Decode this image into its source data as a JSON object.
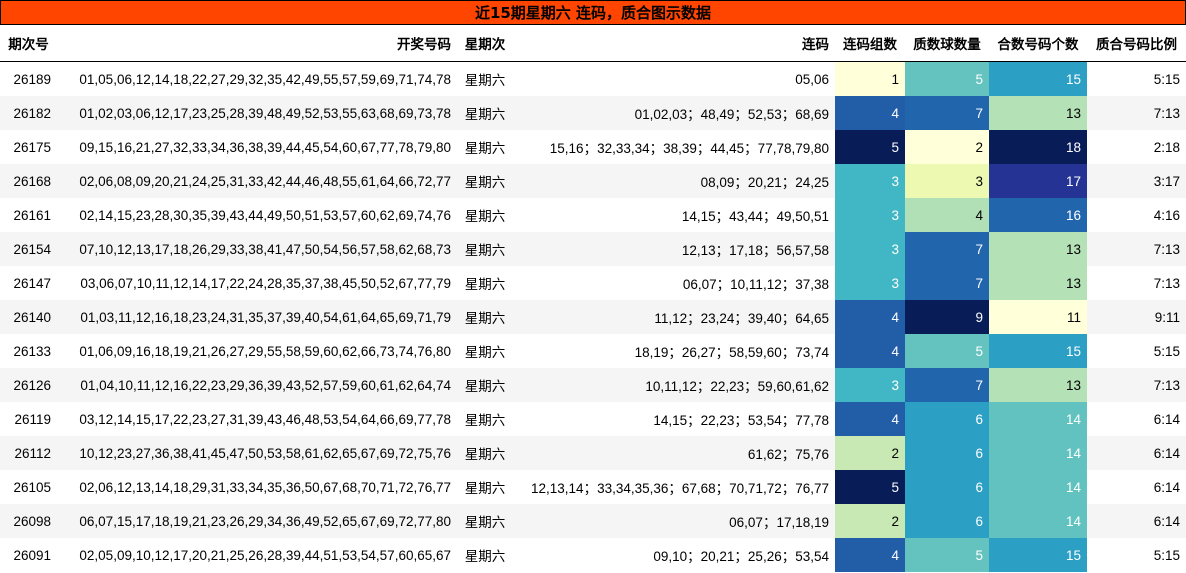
{
  "title": "近15期星期六 连码，质合图示数据",
  "headers": [
    "期次号",
    "开奖号码",
    "星期次",
    "连码",
    "连码组数",
    "质数球数量",
    "合数号码个数",
    "质合号码比例"
  ],
  "rows": [
    {
      "issue": "26189",
      "numbers": "01,05,06,12,14,18,22,27,29,32,35,42,49,55,57,59,69,71,74,78",
      "weekday": "星期六",
      "consecutive": "05,06",
      "groups": "1",
      "primes": "5",
      "composites": "15",
      "ratio": "5:15"
    },
    {
      "issue": "26182",
      "numbers": "01,02,03,06,12,17,23,25,28,39,48,49,52,53,55,63,68,69,73,78",
      "weekday": "星期六",
      "consecutive": "01,02,03；48,49；52,53；68,69",
      "groups": "4",
      "primes": "7",
      "composites": "13",
      "ratio": "7:13"
    },
    {
      "issue": "26175",
      "numbers": "09,15,16,21,27,32,33,34,36,38,39,44,45,54,60,67,77,78,79,80",
      "weekday": "星期六",
      "consecutive": "15,16；32,33,34；38,39；44,45；77,78,79,80",
      "groups": "5",
      "primes": "2",
      "composites": "18",
      "ratio": "2:18"
    },
    {
      "issue": "26168",
      "numbers": "02,06,08,09,20,21,24,25,31,33,42,44,46,48,55,61,64,66,72,77",
      "weekday": "星期六",
      "consecutive": "08,09；20,21；24,25",
      "groups": "3",
      "primes": "3",
      "composites": "17",
      "ratio": "3:17"
    },
    {
      "issue": "26161",
      "numbers": "02,14,15,23,28,30,35,39,43,44,49,50,51,53,57,60,62,69,74,76",
      "weekday": "星期六",
      "consecutive": "14,15；43,44；49,50,51",
      "groups": "3",
      "primes": "4",
      "composites": "16",
      "ratio": "4:16"
    },
    {
      "issue": "26154",
      "numbers": "07,10,12,13,17,18,26,29,33,38,41,47,50,54,56,57,58,62,68,73",
      "weekday": "星期六",
      "consecutive": "12,13；17,18；56,57,58",
      "groups": "3",
      "primes": "7",
      "composites": "13",
      "ratio": "7:13"
    },
    {
      "issue": "26147",
      "numbers": "03,06,07,10,11,12,14,17,22,24,28,35,37,38,45,50,52,67,77,79",
      "weekday": "星期六",
      "consecutive": "06,07；10,11,12；37,38",
      "groups": "3",
      "primes": "7",
      "composites": "13",
      "ratio": "7:13"
    },
    {
      "issue": "26140",
      "numbers": "01,03,11,12,16,18,23,24,31,35,37,39,40,54,61,64,65,69,71,79",
      "weekday": "星期六",
      "consecutive": "11,12；23,24；39,40；64,65",
      "groups": "4",
      "primes": "9",
      "composites": "11",
      "ratio": "9:11"
    },
    {
      "issue": "26133",
      "numbers": "01,06,09,16,18,19,21,26,27,29,55,58,59,60,62,66,73,74,76,80",
      "weekday": "星期六",
      "consecutive": "18,19；26,27；58,59,60；73,74",
      "groups": "4",
      "primes": "5",
      "composites": "15",
      "ratio": "5:15"
    },
    {
      "issue": "26126",
      "numbers": "01,04,10,11,12,16,22,23,29,36,39,43,52,57,59,60,61,62,64,74",
      "weekday": "星期六",
      "consecutive": "10,11,12；22,23；59,60,61,62",
      "groups": "3",
      "primes": "7",
      "composites": "13",
      "ratio": "7:13"
    },
    {
      "issue": "26119",
      "numbers": "03,12,14,15,17,22,23,27,31,39,43,46,48,53,54,64,66,69,77,78",
      "weekday": "星期六",
      "consecutive": "14,15；22,23；53,54；77,78",
      "groups": "4",
      "primes": "6",
      "composites": "14",
      "ratio": "6:14"
    },
    {
      "issue": "26112",
      "numbers": "10,12,23,27,36,38,41,45,47,50,53,58,61,62,65,67,69,72,75,76",
      "weekday": "星期六",
      "consecutive": "61,62；75,76",
      "groups": "2",
      "primes": "6",
      "composites": "14",
      "ratio": "6:14"
    },
    {
      "issue": "26105",
      "numbers": "02,06,12,13,14,18,29,31,33,34,35,36,50,67,68,70,71,72,76,77",
      "weekday": "星期六",
      "consecutive": "12,13,14；33,34,35,36；67,68；70,71,72；76,77",
      "groups": "5",
      "primes": "6",
      "composites": "14",
      "ratio": "6:14"
    },
    {
      "issue": "26098",
      "numbers": "06,07,15,17,18,19,21,23,26,29,34,36,49,52,65,67,69,72,77,80",
      "weekday": "星期六",
      "consecutive": "06,07；17,18,19",
      "groups": "2",
      "primes": "6",
      "composites": "14",
      "ratio": "6:14"
    },
    {
      "issue": "26091",
      "numbers": "02,05,09,10,12,17,20,21,25,26,28,39,44,51,53,54,57,60,65,67",
      "weekday": "星期六",
      "consecutive": "09,10；20,21；25,26；53,54",
      "groups": "4",
      "primes": "5",
      "composites": "15",
      "ratio": "5:15"
    }
  ],
  "colors": {
    "title_bg": "#FF4500",
    "groups": {
      "1": "#FFFFD9",
      "2": "#C8E9B4",
      "3": "#41B6C4",
      "4": "#225EA8",
      "5": "#081D58"
    },
    "primes": {
      "2": "#FFFFD9",
      "3": "#EDF8B1",
      "4": "#B2E0B6",
      "5": "#65C3BF",
      "6": "#2C9FC5",
      "7": "#2165AC",
      "9": "#081D58"
    },
    "composites": {
      "11": "#FFFFD9",
      "13": "#B4E1B6",
      "14": "#62C2BF",
      "15": "#2C9FC4",
      "16": "#2166AC",
      "17": "#253494",
      "18": "#081D58"
    }
  }
}
